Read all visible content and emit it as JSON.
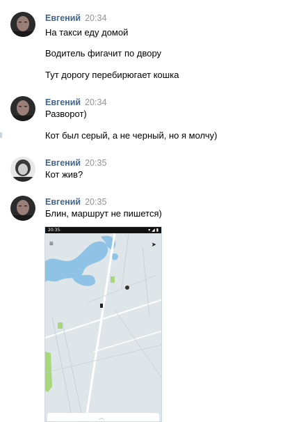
{
  "messages": [
    {
      "author": "Евгений",
      "time": "20:34",
      "lines": [
        "На такси еду домой",
        "Водитель фигачит по двору",
        "Тут дорогу перебирюгает кошка"
      ]
    },
    {
      "author": "Евгений",
      "time": "20:34",
      "lines": [
        "Разворот)",
        "Кот был серый, а не черный, но я молчу)"
      ]
    },
    {
      "author": "Евгений",
      "time": "20:35",
      "lines": [
        "Кот жив?"
      ]
    },
    {
      "author": "Евгений",
      "time": "20:35",
      "lines": [
        "Блин, маршрут не пишется)"
      ]
    }
  ],
  "attachment": {
    "status_time": "20:35",
    "status_icons": "▾ ◢ ▮",
    "menu_icon": "hamburger-menu-icon",
    "locate_icon": "navigation-arrow-icon",
    "colors": {
      "land": "#dfe6ea",
      "water": "#8fc3e6",
      "park": "#a8d67a",
      "road": "#ffffff",
      "street": "#c9d1d6"
    }
  }
}
